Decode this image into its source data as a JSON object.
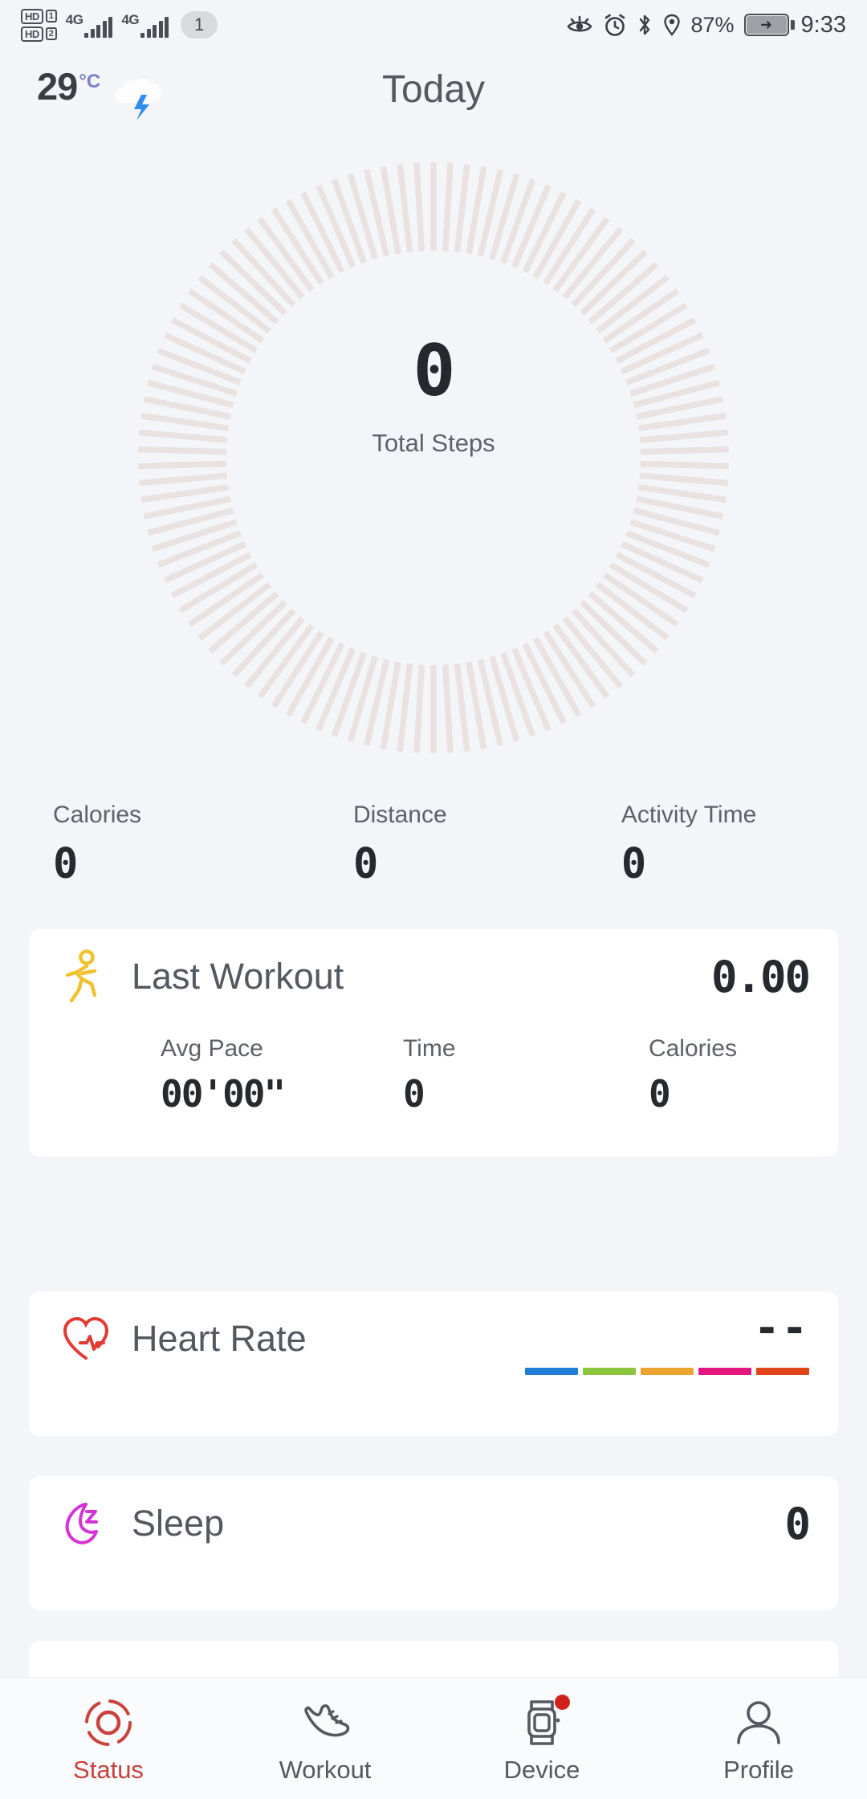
{
  "status_bar": {
    "hd1_label": "HD",
    "hd2_label": "HD",
    "sim1_num": "1",
    "sim2_num": "2",
    "net1": "4G",
    "net2": "4G",
    "notif_count": "1",
    "battery_percent": "87%",
    "time": "9:33",
    "icons": [
      "eye-comfort-icon",
      "alarm-icon",
      "bluetooth-icon",
      "location-icon",
      "battery-charging-icon"
    ]
  },
  "header": {
    "title": "Today",
    "weather_temp": "29",
    "weather_unit": "°C",
    "weather_icon": "cloud-lightning-icon"
  },
  "steps_ring": {
    "value": "0",
    "label": "Total Steps",
    "progress_percent": 0,
    "tick_count": 110,
    "track_color": "#e9e2e0",
    "progress_color": "#c9423c"
  },
  "summary": [
    {
      "label": "Calories",
      "value": "0"
    },
    {
      "label": "Distance",
      "value": "0"
    },
    {
      "label": "Activity Time",
      "value": "0"
    }
  ],
  "cards": {
    "workout": {
      "title": "Last Workout",
      "icon": "running-person-icon",
      "icon_color": "#f0c230",
      "value": "0.00",
      "stats": [
        {
          "label": "Avg Pace",
          "value": "00'00\""
        },
        {
          "label": "Time",
          "value": "0"
        },
        {
          "label": "Calories",
          "value": "0"
        }
      ]
    },
    "heart_rate": {
      "title": "Heart Rate",
      "icon": "heart-pulse-icon",
      "icon_color": "#e23b35",
      "value": "--",
      "zones": [
        {
          "name": "zone-1",
          "color": "#1f7fd4"
        },
        {
          "name": "zone-2",
          "color": "#8cc63e"
        },
        {
          "name": "zone-3",
          "color": "#eba430"
        },
        {
          "name": "zone-4",
          "color": "#e5157f"
        },
        {
          "name": "zone-5",
          "color": "#e0451a"
        }
      ]
    },
    "sleep": {
      "title": "Sleep",
      "icon": "moon-sleep-icon",
      "icon_color": "#d533d5",
      "value": "0"
    }
  },
  "bottom_nav": {
    "items": [
      {
        "label": "Status",
        "icon": "activity-rings-icon",
        "active": true,
        "badge": false
      },
      {
        "label": "Workout",
        "icon": "running-shoe-icon",
        "active": false,
        "badge": false
      },
      {
        "label": "Device",
        "icon": "smartwatch-icon",
        "active": false,
        "badge": true
      },
      {
        "label": "Profile",
        "icon": "person-icon",
        "active": false,
        "badge": false
      }
    ],
    "active_color": "#c9423c",
    "inactive_color": "#54585f",
    "badge_color": "#d0211c"
  }
}
